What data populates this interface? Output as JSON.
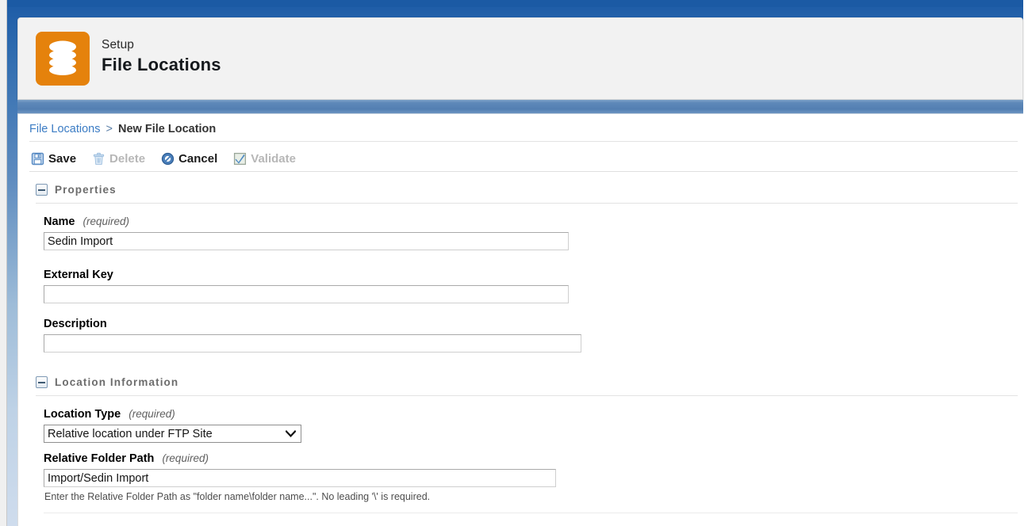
{
  "window": {
    "chrome_top_color": "#1b5aa4",
    "background_gradient_top": "#1d5ba6",
    "background_gradient_bottom": "#cfdced"
  },
  "header": {
    "icon_name": "database-stack-icon",
    "icon_color": "#e5820c",
    "eyebrow": "Setup",
    "title": "File Locations"
  },
  "breadcrumb": {
    "parent": "File Locations",
    "separator": ">",
    "current": "New File Location",
    "link_color": "#3b7cc4"
  },
  "toolbar": {
    "buttons": [
      {
        "label": "Save",
        "icon": "floppy-disk-icon",
        "enabled": true
      },
      {
        "label": "Delete",
        "icon": "trash-can-icon",
        "enabled": false
      },
      {
        "label": "Cancel",
        "icon": "prohibition-circle-icon",
        "enabled": true
      },
      {
        "label": "Validate",
        "icon": "checkbox-check-icon",
        "enabled": false
      }
    ]
  },
  "sections": [
    {
      "title": "Properties",
      "collapse_icon": "minus-box-icon",
      "fields": [
        {
          "label": "Name",
          "required_note": "(required)",
          "type": "text",
          "value": "Sedin Import",
          "placeholder": ""
        },
        {
          "label": "External Key",
          "required_note": "",
          "type": "text",
          "value": "",
          "placeholder": ""
        },
        {
          "label": "Description",
          "required_note": "",
          "type": "text",
          "value": "",
          "placeholder": ""
        }
      ]
    },
    {
      "title": "Location Information",
      "collapse_icon": "minus-box-icon",
      "fields": [
        {
          "label": "Location Type",
          "required_note": "(required)",
          "type": "select",
          "value": "Relative location under FTP Site",
          "options": [
            "Relative location under FTP Site"
          ]
        },
        {
          "label": "Relative Folder Path",
          "required_note": "(required)",
          "type": "text",
          "value": "Import/Sedin Import",
          "placeholder": "",
          "helper": "Enter the Relative Folder Path as \"folder name\\folder name...\". No leading '\\' is required."
        }
      ]
    }
  ]
}
